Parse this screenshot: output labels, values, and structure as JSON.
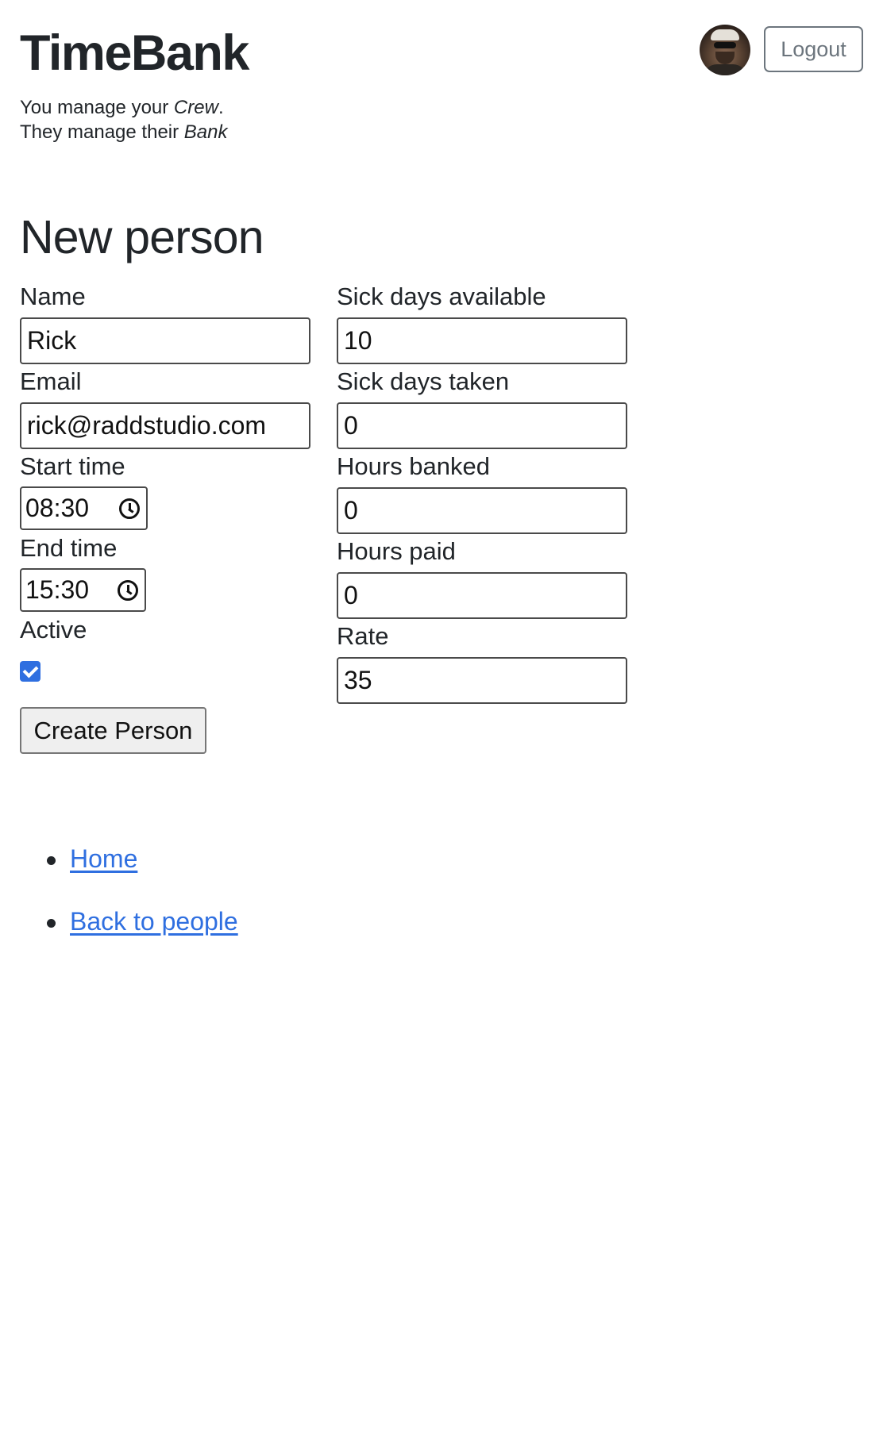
{
  "header": {
    "brand": "TimeBank",
    "tagline_line1_prefix": "You manage your ",
    "tagline_line1_em": "Crew",
    "tagline_line1_suffix": ".",
    "tagline_line2_prefix": "They manage their ",
    "tagline_line2_em": "Bank",
    "logout_label": "Logout"
  },
  "page": {
    "title": "New person"
  },
  "form": {
    "name": {
      "label": "Name",
      "value": "Rick"
    },
    "email": {
      "label": "Email",
      "value": "rick@raddstudio.com"
    },
    "start_time": {
      "label": "Start time",
      "value": "08:30"
    },
    "end_time": {
      "label": "End time",
      "value": "15:30"
    },
    "active": {
      "label": "Active",
      "checked": true
    },
    "sick_days_available": {
      "label": "Sick days available",
      "value": "10"
    },
    "sick_days_taken": {
      "label": "Sick days taken",
      "value": "0"
    },
    "hours_banked": {
      "label": "Hours banked",
      "value": "0"
    },
    "hours_paid": {
      "label": "Hours paid",
      "value": "0"
    },
    "rate": {
      "label": "Rate",
      "value": "35"
    },
    "submit_label": "Create Person"
  },
  "nav": {
    "home": "Home",
    "back": "Back to people"
  },
  "colors": {
    "link": "#2f6fe0",
    "checkbox": "#2f6fe0",
    "logout_border": "#6c757d"
  }
}
